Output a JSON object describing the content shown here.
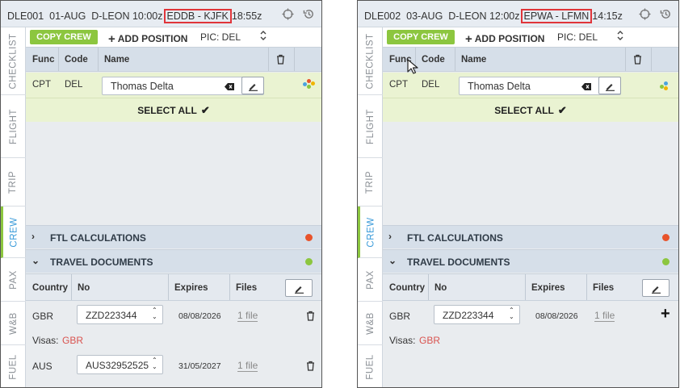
{
  "panels": [
    {
      "flight_id": "DLE001",
      "date": "01-AUG",
      "aircraft": "D-LEON",
      "dep_time": "10:00z",
      "route": "EDDB - KJFK",
      "arr_time": "18:55z",
      "crew_row": {
        "func": "CPT",
        "code": "DEL",
        "name": "Thomas Delta"
      },
      "doc_rows": [
        {
          "country": "GBR",
          "no": "ZZD223344",
          "expires": "08/08/2026",
          "files": "1 file",
          "action": "trash"
        },
        {
          "country": "AUS",
          "no": "AUS32952525",
          "expires": "31/05/2027",
          "files": "1 file",
          "action": "trash"
        }
      ],
      "visas": {
        "label": "Visas:",
        "value": "GBR"
      }
    },
    {
      "flight_id": "DLE002",
      "date": "03-AUG",
      "aircraft": "D-LEON",
      "dep_time": "12:00z",
      "route": "EPWA - LFMN",
      "arr_time": "14:15z",
      "crew_row": {
        "func": "CPT",
        "code": "DEL",
        "name": "Thomas Delta"
      },
      "doc_rows": [
        {
          "country": "GBR",
          "no": "ZZD223344",
          "expires": "08/08/2026",
          "files": "1 file",
          "action": "plus"
        }
      ],
      "visas": {
        "label": "Visas:",
        "value": "GBR"
      }
    }
  ],
  "sidetabs": [
    "CHECKLIST",
    "FLIGHT",
    "TRIP",
    "CREW",
    "PAX",
    "W&B",
    "FUEL"
  ],
  "active_tab": "CREW",
  "actions": {
    "copy_crew": "COPY CREW",
    "add_position": "ADD POSITION",
    "pic": "PIC: DEL"
  },
  "crew_headers": {
    "func": "Func",
    "code": "Code",
    "name": "Name"
  },
  "select_all": "SELECT ALL",
  "sections": {
    "ftl": "FTL CALCULATIONS",
    "travel_docs": "TRAVEL DOCUMENTS"
  },
  "doc_headers": {
    "country": "Country",
    "no": "No",
    "expires": "Expires",
    "files": "Files"
  },
  "colors": {
    "accent_green": "#8cc63f",
    "status_red": "#e8532b",
    "status_green": "#8cc63f",
    "route_highlight": "#e0353a",
    "visa_red": "#d9534f"
  }
}
